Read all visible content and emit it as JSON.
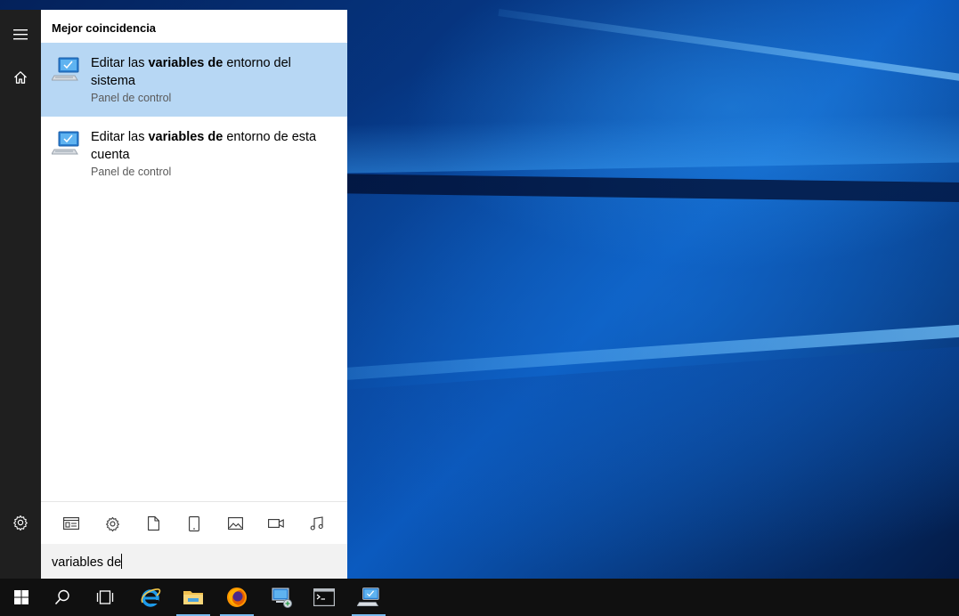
{
  "rail": {
    "items": [
      {
        "icon": "hamburger-menu-icon"
      },
      {
        "icon": "home-icon"
      },
      {
        "icon": "gear-icon"
      }
    ]
  },
  "search_panel": {
    "section_title": "Mejor coincidencia",
    "results": [
      {
        "title_pre": "Editar las ",
        "title_bold": "variables de",
        "title_post": " entorno del sistema",
        "subtitle": "Panel de control",
        "icon": "control-panel-icon",
        "selected": true
      },
      {
        "title_pre": "Editar las ",
        "title_bold": "variables de",
        "title_post": " entorno de esta cuenta",
        "subtitle": "Panel de control",
        "icon": "control-panel-icon",
        "selected": false
      }
    ],
    "filters": [
      "apps-filter-icon",
      "settings-filter-icon",
      "documents-filter-icon",
      "tablet-filter-icon",
      "photos-filter-icon",
      "videos-filter-icon",
      "music-filter-icon"
    ],
    "search_value": "variables de"
  },
  "taskbar": {
    "items": [
      {
        "icon": "windows-start-icon",
        "active": false
      },
      {
        "icon": "search-icon",
        "active": false
      },
      {
        "icon": "task-view-icon",
        "active": false
      },
      {
        "icon": "internet-explorer-icon",
        "active": false
      },
      {
        "icon": "file-explorer-icon",
        "active": true
      },
      {
        "icon": "firefox-icon",
        "active": true
      },
      {
        "icon": "network-computer-icon",
        "active": false
      },
      {
        "icon": "command-prompt-icon",
        "active": false
      },
      {
        "icon": "control-panel-icon",
        "active": true
      }
    ]
  },
  "colors": {
    "selected_row": "#b7d7f4",
    "rail_bg": "#1f1f1f",
    "taskbar_bg": "#101010",
    "active_indicator": "#76b9ed"
  }
}
